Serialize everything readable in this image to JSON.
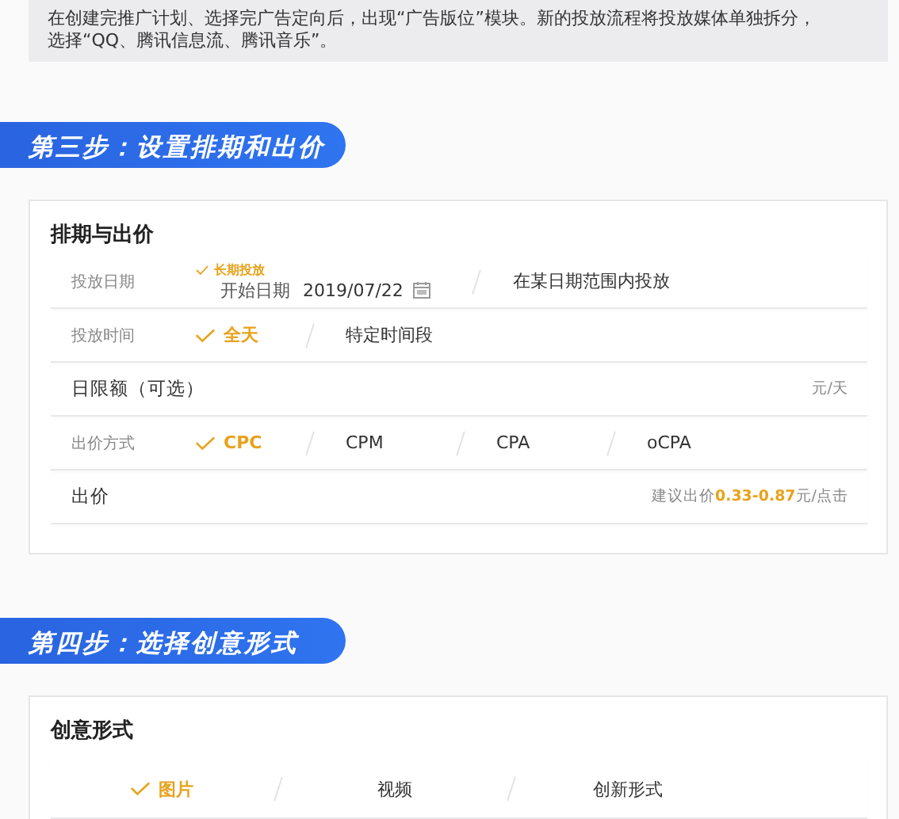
{
  "note": {
    "text": "在创建完推广计划、选择完广告定向后，出现“广告版位”模块。新的投放流程将投放媒体单独拆分，选择“QQ、腾讯信息流、腾讯音乐”。"
  },
  "steps": [
    {
      "banner": "第三步：设置排期和出价",
      "card": {
        "title": "排期与出价",
        "rows": [
          {
            "kind": "choice",
            "label": "投放日期",
            "options": [
              {
                "label": "长期投放",
                "selected": true,
                "sub_label": "开始日期",
                "sub_value": "2019/07/22"
              },
              {
                "label": "在某日期范围内投放",
                "selected": false
              }
            ]
          },
          {
            "kind": "choice",
            "label": "投放时间",
            "options": [
              {
                "label": "全天",
                "selected": true
              },
              {
                "label": "特定时间段",
                "selected": false
              }
            ]
          },
          {
            "kind": "input",
            "label": "日限额（可选）",
            "unit": "元/天"
          },
          {
            "kind": "choice",
            "label": "出价方式",
            "options": [
              {
                "label": "CPC",
                "selected": true
              },
              {
                "label": "CPM",
                "selected": false
              },
              {
                "label": "CPA",
                "selected": false
              },
              {
                "label": "oCPA",
                "selected": false
              }
            ]
          },
          {
            "kind": "bid",
            "label": "出价",
            "hint_before": "建议出价",
            "hint_value": "0.33-0.87",
            "hint_after": "元/点击"
          }
        ]
      }
    },
    {
      "banner": "第四步：选择创意形式",
      "card": {
        "title": "创意形式",
        "rows": [
          {
            "kind": "tabs",
            "options": [
              {
                "label": "图片",
                "selected": true
              },
              {
                "label": "视频",
                "selected": false
              },
              {
                "label": "创新形式",
                "selected": false
              }
            ]
          }
        ]
      }
    }
  ]
}
